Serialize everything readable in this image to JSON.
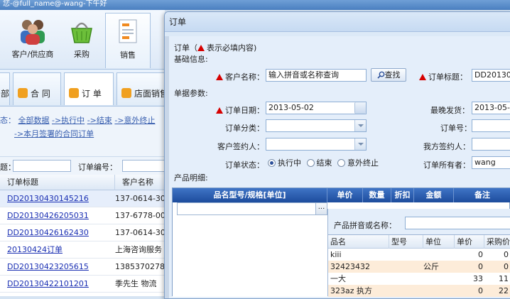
{
  "app": {
    "title": "您-@full_name@-wang-下午好"
  },
  "ribbon": {
    "items": [
      {
        "label": "客户/供应商"
      },
      {
        "label": "采购"
      },
      {
        "label": "销售"
      }
    ]
  },
  "doc_tabs": [
    {
      "label": "部"
    },
    {
      "label": "合  同"
    },
    {
      "label": "订  单"
    },
    {
      "label": "店面销售"
    }
  ],
  "filters": {
    "prefix": "态：",
    "options": [
      "全部数据",
      "->执行中",
      "->结束",
      "->意外终止"
    ],
    "tail": "->本月签署的合同订单"
  },
  "search_bar": {
    "left_label": "题：",
    "order_no_label": "订单编号："
  },
  "list": {
    "headers": [
      "订单标题",
      "客户名称"
    ],
    "rows": [
      {
        "title": "DD20130430145216",
        "customer": "137-0614-30"
      },
      {
        "title": "DD20130426205031",
        "customer": "137-6778-00"
      },
      {
        "title": "DD20130426162430",
        "customer": "137-0614-30"
      },
      {
        "title": "20130424订单",
        "customer": "上海咨询服务"
      },
      {
        "title": "DD20130423205615",
        "customer": "13853702789"
      },
      {
        "title": "DD20130422101201",
        "customer": "季先生 物流"
      }
    ]
  },
  "dialog": {
    "title": "订单",
    "required_note_prefix": "订单（",
    "required_note_suffix": "表示必填内容)",
    "basic_section": "基础信息:",
    "customer_label": "客户名称：",
    "customer_placeholder": "输入拼音或名称查询",
    "search_button": "查找",
    "order_title_label": "订单标题：",
    "order_title_value": "DD20130",
    "doc_section": "单据参数:",
    "order_date_label": "订单日期：",
    "order_date_value": "2013-05-02",
    "latest_ship_label": "最晚发货：",
    "latest_ship_value": "2013-05-0",
    "category_label": "订单分类：",
    "order_no_label": "订单号：",
    "customer_signer_label": "客户签约人：",
    "our_signer_label": "我方签约人：",
    "status_label": "订单状态：",
    "status_options": [
      "执行中",
      "结束",
      "意外终止"
    ],
    "owner_label": "订单所有者：",
    "owner_value": "wang",
    "products_section": "产品明细:"
  },
  "product_grid": {
    "headers": [
      "品名型号/规格[单位]",
      "单价",
      "数量",
      "折扣",
      "金额",
      "备注"
    ],
    "ellipsis": "..."
  },
  "product_popup": {
    "search_label": "产品拼音或名称：",
    "headers": [
      "品名",
      "型号",
      "单位",
      "单价",
      "采购价"
    ],
    "rows": [
      {
        "name": "kiii",
        "model": "",
        "unit": "",
        "price": "0",
        "purchase": "0"
      },
      {
        "name": "32423432",
        "model": "",
        "unit": "公斤",
        "price": "0",
        "purchase": "0"
      },
      {
        "name": "一大",
        "model": "",
        "unit": "",
        "price": "33",
        "purchase": "11"
      },
      {
        "name": "323az 执方",
        "model": "",
        "unit": "",
        "price": "0",
        "purchase": "22"
      }
    ]
  }
}
